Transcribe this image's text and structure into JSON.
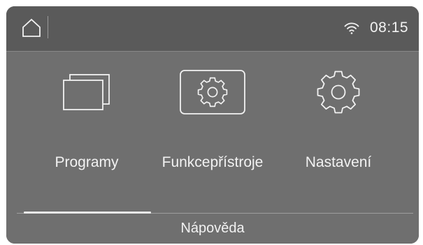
{
  "statusbar": {
    "home_icon": "home-icon",
    "wifi_icon": "wifi-icon",
    "time": "08:15"
  },
  "menu": {
    "items": [
      {
        "label": "Programy",
        "icon": "windows-stack-icon"
      },
      {
        "label": "Funkce přístroje",
        "icon": "gear-in-frame-icon"
      },
      {
        "label": "Nastavení",
        "icon": "gear-icon"
      }
    ]
  },
  "footer": {
    "help_label": "Nápověda"
  },
  "colors": {
    "screen_background": "#6f6f6f",
    "statusbar_background": "#5a5a5a",
    "foreground": "#f2f2f2"
  }
}
